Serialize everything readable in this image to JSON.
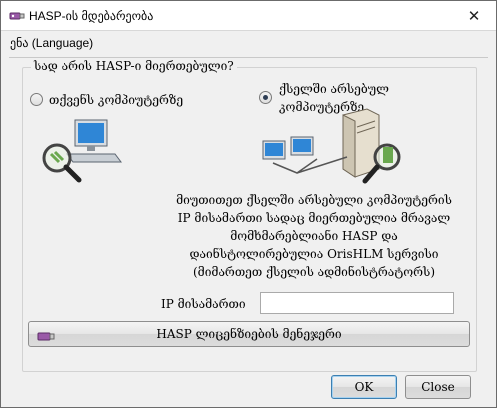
{
  "window": {
    "title": "HASP-ის მდებარეობა",
    "close_glyph": "✕"
  },
  "menu": {
    "language": "ენა (Language)"
  },
  "group": {
    "title": "სად არის HASP-ი მიერთებული?"
  },
  "options": {
    "local": {
      "label": "თქვენს კომპიუტერზე",
      "checked": false
    },
    "network": {
      "label_line1": "ქსელში არსებულ",
      "label_line2": "კომპიუტერზე",
      "checked": true
    }
  },
  "description": {
    "line1": "მიუთითეთ ქსელში არსებული კომპიუტერის",
    "line2": "IP მისამართი სადაც მიერთებულია მრავალ",
    "line3": "მომხმარებლიანი HASP და",
    "line4": "დაინსტოლირებულია OrisHLM სერვისი",
    "line5": "(მიმართეთ ქსელის ადმინისტრატორს)"
  },
  "ip": {
    "label": "IP მისამართი",
    "value": ""
  },
  "buttons": {
    "license_manager": "HASP ლიცენზიების მენეჯერი",
    "ok": "OK",
    "close": "Close"
  },
  "icons": {
    "app": "hasp-key-icon",
    "local": "computer-magnifier-icon",
    "network": "network-server-icon",
    "usb": "usb-key-icon"
  }
}
